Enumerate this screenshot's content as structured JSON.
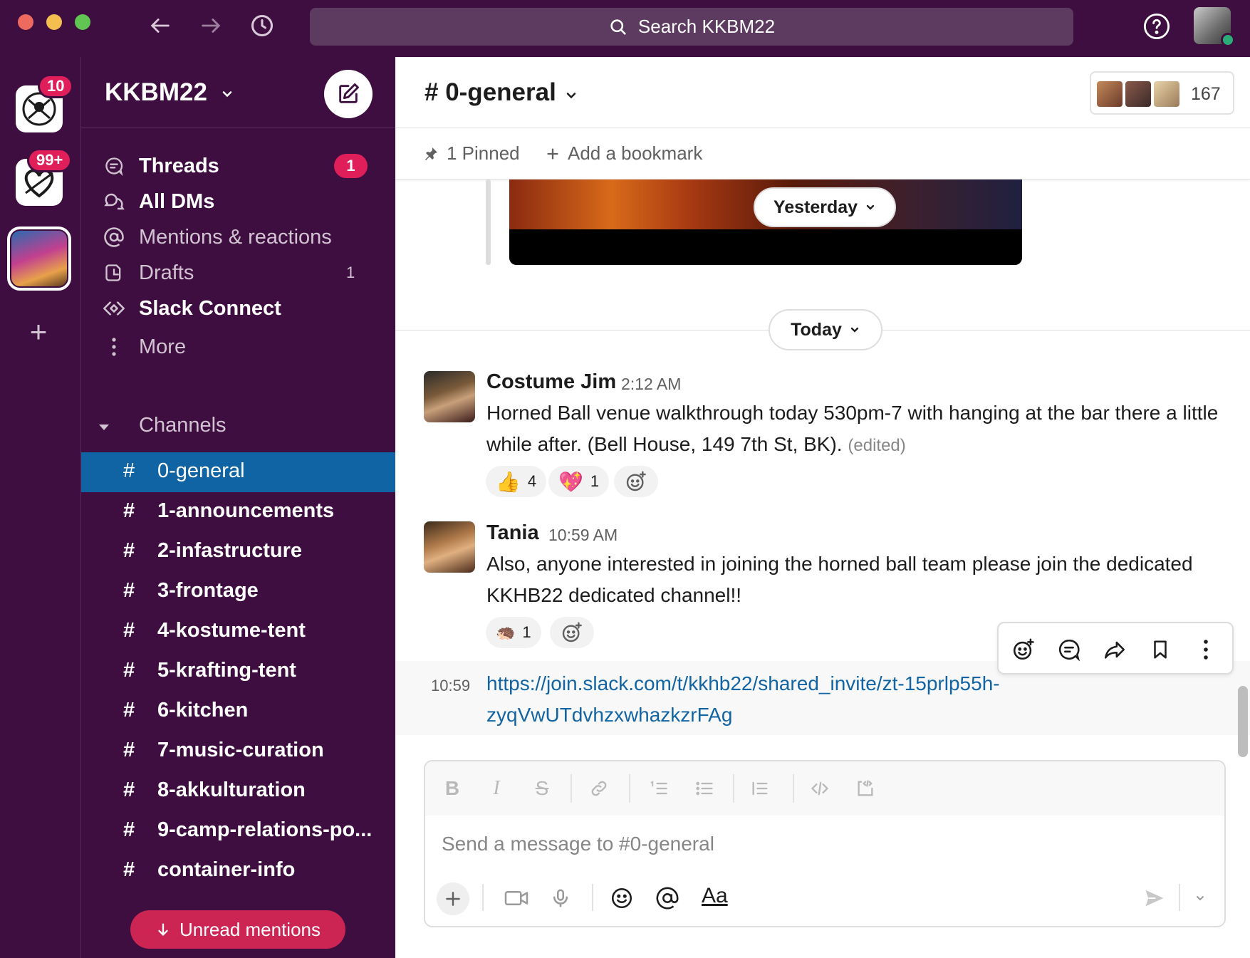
{
  "search": {
    "label": "Search KKBM22"
  },
  "rail": {
    "workspaces": [
      {
        "badge": "10"
      },
      {
        "badge": "99+"
      },
      {
        "badge": ""
      }
    ]
  },
  "sidebar": {
    "workspace_name": "KKBM22",
    "nav": [
      {
        "label": "Threads",
        "icon": "threads-icon",
        "badge": "1"
      },
      {
        "label": "All DMs",
        "icon": "dm-icon"
      },
      {
        "label": "Mentions & reactions",
        "icon": "at-icon"
      },
      {
        "label": "Drafts",
        "icon": "drafts-icon",
        "count": "1"
      },
      {
        "label": "Slack Connect",
        "icon": "slack-connect-icon"
      },
      {
        "label": "More",
        "icon": "more-vertical-icon"
      }
    ],
    "channels_header": "Channels",
    "channels": [
      {
        "name": "0-general",
        "active": true
      },
      {
        "name": "1-announcements"
      },
      {
        "name": "2-infastructure"
      },
      {
        "name": "3-frontage"
      },
      {
        "name": "4-kostume-tent"
      },
      {
        "name": "5-krafting-tent"
      },
      {
        "name": "6-kitchen"
      },
      {
        "name": "7-music-curation"
      },
      {
        "name": "8-akkulturation"
      },
      {
        "name": "9-camp-relations-po..."
      },
      {
        "name": "container-info"
      }
    ],
    "unread_mentions": "Unread mentions"
  },
  "channel": {
    "title": "# 0-general",
    "member_count": "167",
    "pinned": "1 Pinned",
    "add_bookmark": "Add a bookmark"
  },
  "day_pills": {
    "yesterday": "Yesterday",
    "today": "Today"
  },
  "messages": [
    {
      "author": "Costume Jim",
      "time": "2:12 AM",
      "text": "Horned Ball venue walkthrough today 530pm-7 with hanging at the bar there a little while after. (Bell House, 149 7th St, BK).",
      "edited": "(edited)",
      "reactions": [
        {
          "emoji": "👍",
          "count": "4"
        },
        {
          "emoji": "💖",
          "count": "1"
        }
      ]
    },
    {
      "author": "Tania",
      "time": "10:59 AM",
      "text": "Also, anyone interested in joining the horned ball team please join the dedicated KKHB22 dedicated channel!!",
      "reactions": [
        {
          "emoji": "🦔",
          "count": "1"
        }
      ]
    }
  ],
  "followup": {
    "time": "10:59",
    "link": "https://join.slack.com/t/kkhb22/shared_invite/zt-15prlp55h-zyqVwUTdvhzxwhazkzrFAg"
  },
  "composer": {
    "placeholder": "Send a message to #0-general",
    "format_label": "Aa"
  },
  "colors": {
    "aubergine": "#3f0e40",
    "active_channel": "#1164a3",
    "badge": "#e01e5a",
    "link": "#1264a3"
  }
}
